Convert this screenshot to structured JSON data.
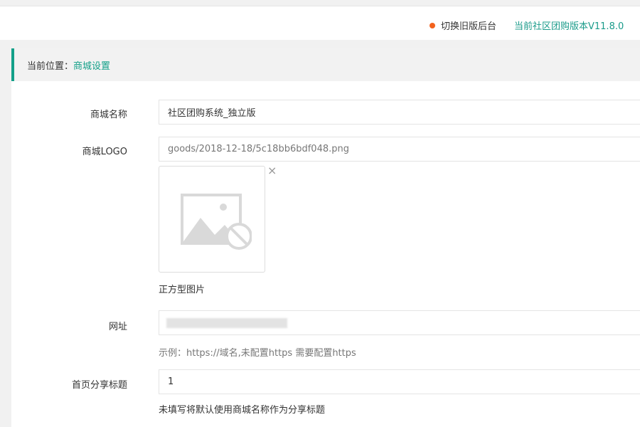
{
  "topbar": {
    "switch_label": "切换旧版后台",
    "version_label": "当前社区团购版本V11.8.0"
  },
  "breadcrumb": {
    "prefix": "当前位置：",
    "current": "商城设置"
  },
  "form": {
    "shop_name": {
      "label": "商城名称",
      "value": "社区团购系统_独立版"
    },
    "shop_logo": {
      "label": "商城LOGO",
      "value": "goods/2018-12-18/5c18bb6bdf048.png",
      "hint": "正方型图片"
    },
    "site_url": {
      "label": "网址",
      "hint": "示例：https://域名,未配置https 需要配置https"
    },
    "share_title": {
      "label": "首页分享标题",
      "value": "1",
      "hint": "未填写将默认使用商城名称作为分享标题"
    }
  },
  "colors": {
    "accent": "#13a089",
    "dot": "#f3621d"
  },
  "icons": {
    "logo_placeholder": "broken-image-icon",
    "remove": "close-icon"
  }
}
